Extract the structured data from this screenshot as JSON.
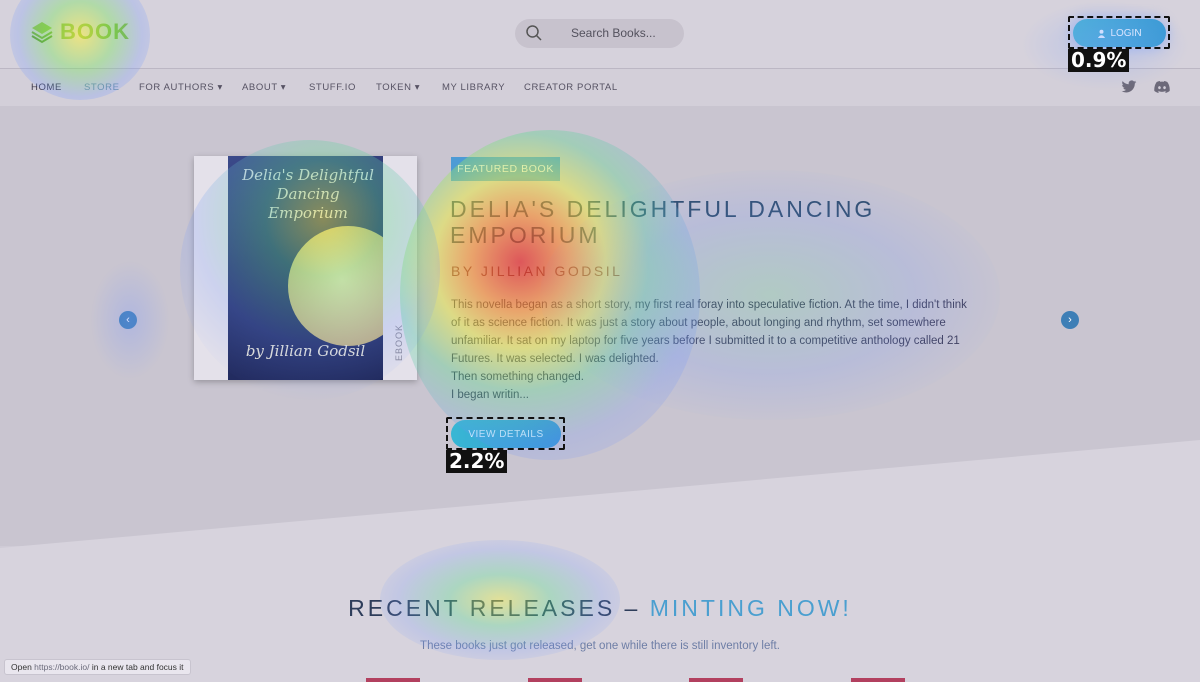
{
  "logo": {
    "text": "BOOK"
  },
  "search": {
    "placeholder": "Search Books..."
  },
  "login": {
    "label": "LOGIN",
    "click_share": "0.9%"
  },
  "nav": {
    "items": [
      {
        "label": "HOME"
      },
      {
        "label": "STORE"
      },
      {
        "label": "FOR AUTHORS ▾"
      },
      {
        "label": "ABOUT ▾"
      },
      {
        "label": "STUFF.IO"
      },
      {
        "label": "TOKEN ▾"
      },
      {
        "label": "MY LIBRARY"
      },
      {
        "label": "CREATOR PORTAL"
      }
    ]
  },
  "featured": {
    "badge": "FEATURED BOOK",
    "title": "DELIA'S DELIGHTFUL DANCING EMPORIUM",
    "author": "BY JILLIAN GODSIL",
    "cover_title": "Delia's Delightful Dancing Emporium",
    "cover_author": "by Jillian Godsil",
    "cover_tab": "EBOOK",
    "description": [
      "This novella began as a short story, my first real foray into speculative fiction. At the time, I didn't think",
      "of it as science fiction. It was just a story about people, about longing and rhythm, set somewhere",
      "unfamiliar. It sat on my laptop for five years before I submitted it to a competitive anthology called 21",
      "Futures. It was selected. I was delighted.",
      "Then something changed.",
      "I began writin..."
    ],
    "button": "VIEW DETAILS",
    "click_share": "2.2%"
  },
  "recent": {
    "title_a": "RECENT RELEASES –",
    "title_b": "MINTING NOW!",
    "subtitle": "These books just got released, get one while there is still inventory left."
  },
  "status": {
    "prefix": "Open",
    "url": "https://book.io/",
    "suffix": "in a new tab and focus it"
  },
  "colors": {
    "accent": "#4d9bd5",
    "logo": "#7cb342",
    "card": "#b2405f"
  }
}
